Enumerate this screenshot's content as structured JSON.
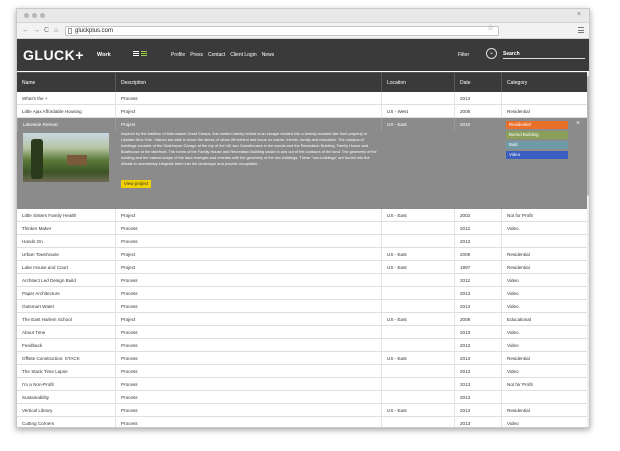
{
  "browser": {
    "url": "gluckplus.com",
    "back_glyph": "←",
    "forward_glyph": "→",
    "reload_glyph": "C",
    "home_glyph": "⌂",
    "close_glyph": "×",
    "star_glyph": "☆",
    "icons": [
      "back-arrow-icon",
      "forward-arrow-icon",
      "reload-icon",
      "home-icon",
      "star-icon",
      "menu-icon"
    ]
  },
  "site": {
    "logo": "GLUCK+",
    "work_label": "Work",
    "nav": [
      "Profile",
      "Press",
      "Contact",
      "Client Login",
      "News"
    ],
    "filter_label": "Filter",
    "filter_glyph": "⌄",
    "search_label": "Search"
  },
  "table": {
    "headers": {
      "name": "Name",
      "description": "Description",
      "location": "Location",
      "date": "Date",
      "category": "Category"
    },
    "rows_top": [
      {
        "name": "What's the +",
        "description": "Process",
        "location": "",
        "date": "2013",
        "category": ""
      },
      {
        "name": "Little Ajax Affordable Housing",
        "description": "Project",
        "location": "US - West",
        "date": "2006",
        "category": "Residential"
      }
    ],
    "expanded": {
      "name": "Lakeside Retreat",
      "description_type": "Project",
      "location": "US - East",
      "date": "2010",
      "text": "Inspired by the tradition of Adirondack Great Camps, this modern family retreat is an escape nestled into a heavily wooded site front property in Upstate New York. Visitors are able to leave the stress of urban life behind and focus on nature, friends, family and relaxation. The campus of buildings consists of the Gatehouse Garage at the top of the hill, two Guesthouses in the woods and the Recreation Building, Family House and Boathouse at the lakefront. The forms of the Family House and Recreation Building snake in and out of the contours of the land. The geometry of the building and the natural shape of the land emerges and recedes with the geometry of the two buildings. These \"non-buildings\" are buried into the hillside to seamlessly integrate them into the landscape and provide occupiable...",
      "view_button": "View project",
      "close_glyph": "×",
      "categories": [
        {
          "label": "Residential",
          "color": "#e8702a"
        },
        {
          "label": "Buried Building",
          "color": "#8aa05a"
        },
        {
          "label": "Built",
          "color": "#6f9aa6"
        },
        {
          "label": "Video",
          "color": "#3b5fc0"
        }
      ]
    },
    "rows_bottom": [
      {
        "name": "Little Sisters Family Health",
        "description": "Project",
        "location": "US - East",
        "date": "2002",
        "category": "Not for Profit"
      },
      {
        "name": "Thinker Maker",
        "description": "Process",
        "location": "",
        "date": "2012",
        "category": "Video"
      },
      {
        "name": "Hands On",
        "description": "Process",
        "location": "",
        "date": "2013",
        "category": ""
      },
      {
        "name": "Urban Townhouse",
        "description": "Project",
        "location": "US - East",
        "date": "2009",
        "category": "Residential"
      },
      {
        "name": "Lake House and Court",
        "description": "Project",
        "location": "US - East",
        "date": "1997",
        "category": "Residential"
      },
      {
        "name": "Architect Led Design Build",
        "description": "Process",
        "location": "",
        "date": "2012",
        "category": "Video"
      },
      {
        "name": "Paper Architecture",
        "description": "Process",
        "location": "",
        "date": "2013",
        "category": "Video"
      },
      {
        "name": "Outsmart Water",
        "description": "Process",
        "location": "",
        "date": "2013",
        "category": "Video"
      },
      {
        "name": "The East Harlem School",
        "description": "Project",
        "location": "US - East",
        "date": "2008",
        "category": "Educational"
      },
      {
        "name": "About Time",
        "description": "Process",
        "location": "",
        "date": "2013",
        "category": "Video"
      },
      {
        "name": "Feedback",
        "description": "Process",
        "location": "",
        "date": "2013",
        "category": "Video"
      },
      {
        "name": "Offsite Construction: STACK",
        "description": "Process",
        "location": "US - East",
        "date": "2013",
        "category": "Residential"
      },
      {
        "name": "The Stack Time Lapse",
        "description": "Process",
        "location": "",
        "date": "2013",
        "category": "Video"
      },
      {
        "name": "I'm a Non-Profit",
        "description": "Process",
        "location": "",
        "date": "2013",
        "category": "Not for Profit"
      },
      {
        "name": "Sustainability",
        "description": "Process",
        "location": "",
        "date": "2013",
        "category": ""
      },
      {
        "name": "Vertical Library",
        "description": "Process",
        "location": "US - East",
        "date": "2013",
        "category": "Residential"
      },
      {
        "name": "Cutting Corners",
        "description": "Process",
        "location": "",
        "date": "2013",
        "category": "Video"
      }
    ]
  }
}
